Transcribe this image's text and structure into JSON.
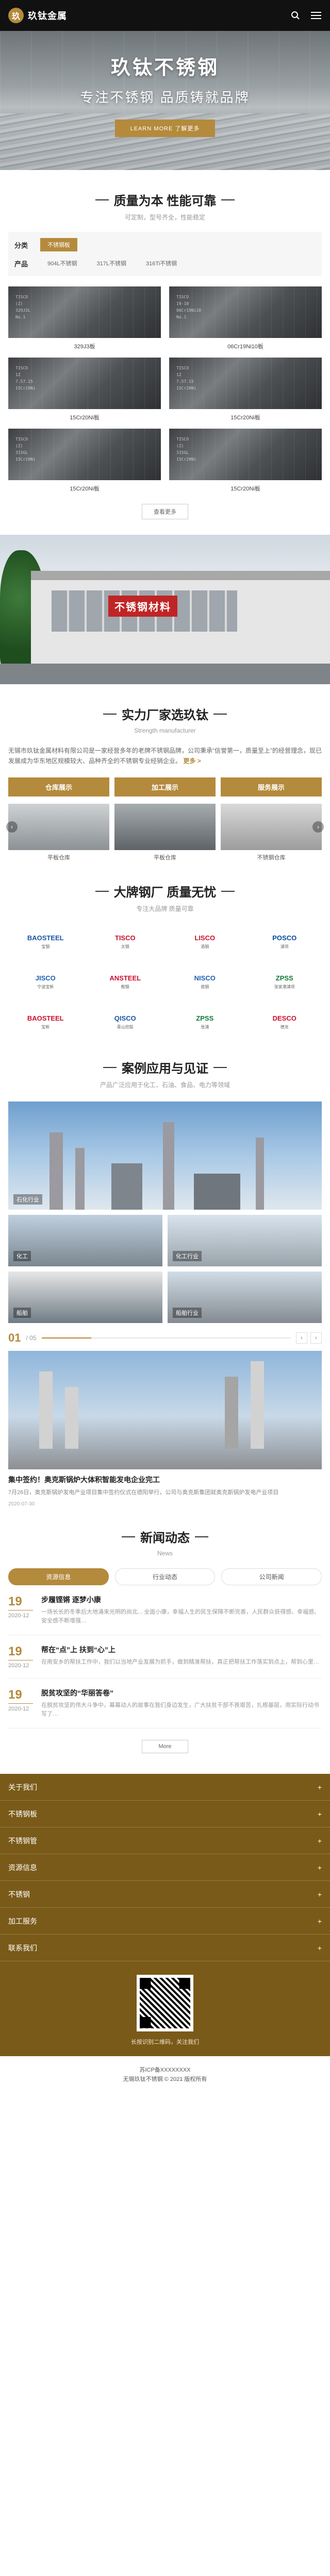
{
  "header": {
    "logo_mark": "玖",
    "brand": "玖钛金属",
    "search_icon": "search-icon",
    "menu_icon": "menu-icon"
  },
  "hero": {
    "title": "玖钛不锈钢",
    "subtitle": "专注不锈钢 品质铸就品牌",
    "button": "LEARN MORE 了解更多"
  },
  "products": {
    "title": "质量为本 性能可靠",
    "subtitle": "可定制，型号齐全，性能稳定",
    "filters": [
      {
        "label": "分类",
        "options": [
          "不锈钢板"
        ],
        "active": 0
      },
      {
        "label": "产品",
        "options": [
          "904L不锈钢",
          "317L不锈钢",
          "316Ti不锈钢"
        ],
        "active": -1
      }
    ],
    "items": [
      {
        "name": "329J3板",
        "stamp": "TISCO\n(Z)\n329J3L\nNo.1"
      },
      {
        "name": "06Cr19Ni10板",
        "stamp": "TISCO\n19-10\n06Cr19Ni10\nNo.1"
      },
      {
        "name": "15Cr20Ni板",
        "stamp": "TISCO\n1Z\n7.57.15\n15Cr20Ni"
      },
      {
        "name": "15Cr20Ni板",
        "stamp": "TISCO\n1Z\n7.57.15\n15Cr20Ni"
      },
      {
        "name": "15Cr20Ni板",
        "stamp": "TISCO\n(Z)\n315GL\n15Cr20Ni"
      },
      {
        "name": "15Cr20Ni板",
        "stamp": "TISCO\n(Z)\n315GL\n15Cr20Ni"
      }
    ],
    "more": "查看更多"
  },
  "strength": {
    "sign": "不锈钢材料",
    "title": "实力厂家选玖钛",
    "subtitle": "Strength manufacturer",
    "text": "无锡市玖钛金属材料有限公司是一家经营多年的老牌不锈钢品牌，公司秉承“信誉第一，质量至上”的经营理念，现已发展成为华东地区规模较大、品种齐全的不锈钢专业经销企业。",
    "more": "更多 >",
    "tabs": [
      "仓库展示",
      "加工展示",
      "服务展示"
    ],
    "carousel": [
      "平板仓库",
      "平板仓库",
      "不锈钢仓库"
    ],
    "arrow_left": "‹",
    "arrow_right": "›"
  },
  "brands": {
    "title": "大牌钢厂 质量无忧",
    "subtitle": "专注大品牌 质量可靠",
    "items": [
      {
        "name": "BAOSTEEL",
        "sub": "宝钢",
        "color": "#1a55a3"
      },
      {
        "name": "TISCO",
        "sub": "太钢",
        "color": "#c8102e"
      },
      {
        "name": "LISCO",
        "sub": "酒钢",
        "color": "#c8102e"
      },
      {
        "name": "POSCO",
        "sub": "浦项",
        "color": "#004a99"
      },
      {
        "name": "JISCO",
        "sub": "宁波宝新",
        "color": "#1e5fb4"
      },
      {
        "name": "ANSTEEL",
        "sub": "鞍钢",
        "color": "#c8102e"
      },
      {
        "name": "NISCO",
        "sub": "南钢",
        "color": "#1e5fb4"
      },
      {
        "name": "ZPSS",
        "sub": "张家港浦项",
        "color": "#0a7a3a"
      },
      {
        "name": "BAOSTEEL",
        "sub": "宝新",
        "color": "#c8102e"
      },
      {
        "name": "QISCO",
        "sub": "青山控股",
        "color": "#1a55a3"
      },
      {
        "name": "ZPSS",
        "sub": "张浦",
        "color": "#0a7a3a"
      },
      {
        "name": "DESCO",
        "sub": "德龙",
        "color": "#c8102e"
      }
    ]
  },
  "cases": {
    "title": "案例应用与见证",
    "subtitle": "产品广泛应用于化工、石油、食品、电力等领域",
    "big_label": "石化行业",
    "small": [
      "化工",
      "化工行业",
      "船舶",
      "船舶行业"
    ],
    "pager_num": "01",
    "pager_total": "/ 05",
    "pager_progress": 0.2,
    "prev": "‹",
    "next": "›",
    "feature_title": "集中签约！奥克斯锅炉大体积智能发电企业完工",
    "feature_desc": "7月26日，奥克斯锅炉发电产业项目集中签约仪式在德阳举行，公司与奥克斯集团就奥克斯锅炉发电产业项目",
    "feature_date": "2020-07-30"
  },
  "news": {
    "title": "新闻动态",
    "subtitle": "News",
    "tabs": [
      "资源信息",
      "行业动态",
      "公司新闻"
    ],
    "active_tab": 0,
    "items": [
      {
        "day": "19",
        "ym": "2020-12",
        "title": "步履铿锵 逐梦小康",
        "desc": "一场长长的冬季后大地涌来光明的尚北... 全面小康，幸福人生的民生保障不断完善，人民群众获得感、幸福感、安全感不断增强…"
      },
      {
        "day": "19",
        "ym": "2020-12",
        "title": "帮在“点”上 扶到“心”上",
        "desc": "在南安乡的帮扶工作中，我们以当地产业发展为抓手，做到精准帮扶，真正把帮扶工作落实到点上，帮到心里…"
      },
      {
        "day": "19",
        "ym": "2020-12",
        "title": "脱贫攻坚的“华丽答卷”",
        "desc": "在脱贫攻坚的伟大斗争中，幕幕动人的故事在我们身边发生，广大扶贫干部不畏艰苦，扎根基层，用实际行动书写了…"
      }
    ],
    "more": "More"
  },
  "footer": {
    "items": [
      "关于我们",
      "不锈钢板",
      "不锈钢管",
      "资源信息",
      "不锈钢",
      "加工服务",
      "联系我们"
    ],
    "qr_tip": "长按识别二维码，关注我们",
    "icp": "苏ICP备XXXXXXXX",
    "copyright": "无锡玖钛不锈钢 © 2021 版权所有"
  }
}
